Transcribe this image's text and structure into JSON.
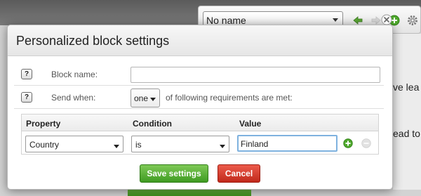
{
  "background": {
    "toolbar_select_value": "No name",
    "text_fragment_1": "ve lea",
    "text_fragment_2": "ead to"
  },
  "dialog": {
    "title": "Personalized block settings",
    "block_name_label": "Block name:",
    "block_name_value": "",
    "send_when_label": "Send when:",
    "send_when_value": "one",
    "send_when_suffix": "of following requirements are met:",
    "table": {
      "headers": {
        "property": "Property",
        "condition": "Condition",
        "value": "Value"
      },
      "rows": [
        {
          "property": "Country",
          "condition": "is",
          "value": "Finland"
        }
      ]
    },
    "save_label": "Save settings",
    "cancel_label": "Cancel",
    "help_glyph": "?"
  },
  "colors": {
    "save_green": "#4ea82c",
    "cancel_red": "#d23a2b",
    "focus_blue": "#7fb2df"
  }
}
